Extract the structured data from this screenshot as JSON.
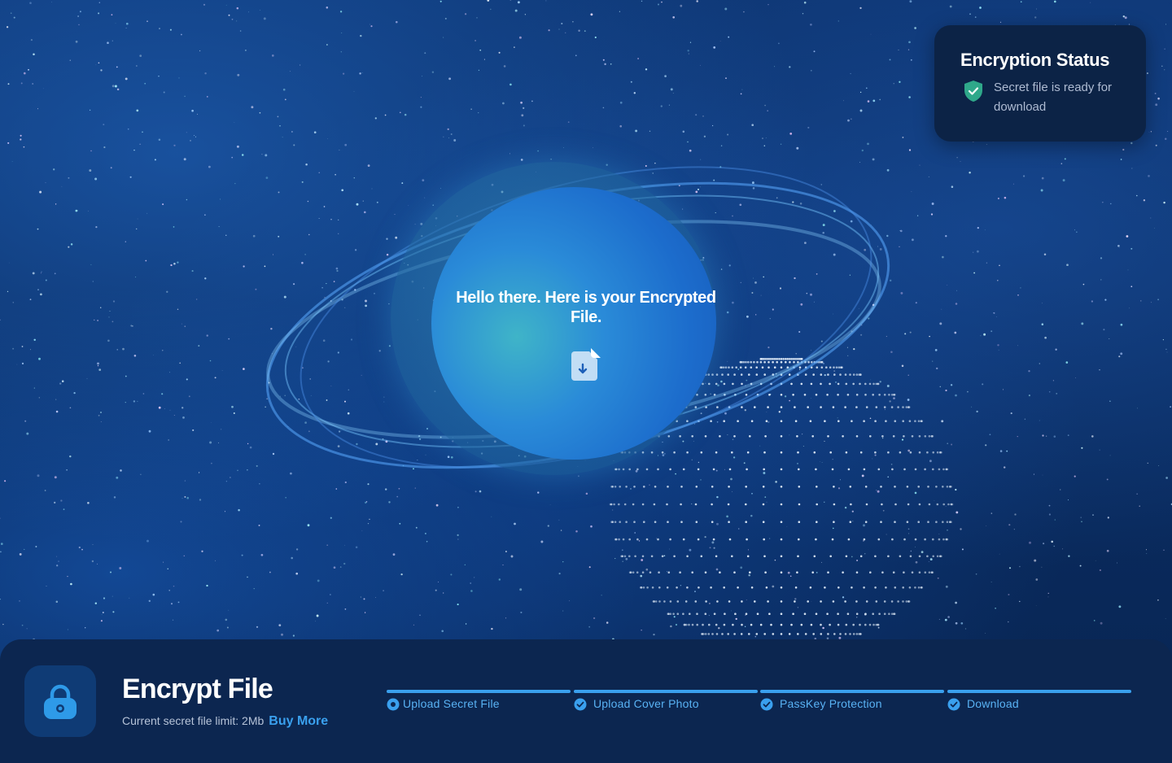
{
  "status_card": {
    "title": "Encryption Status",
    "message": "Secret file is ready for download",
    "icon": "shield-check-icon"
  },
  "main": {
    "message": "Hello there. Here is your Encrypted File.",
    "download_icon": "file-download-icon"
  },
  "bottom_bar": {
    "title": "Encrypt File",
    "limit_text": "Current secret file limit: 2Mb",
    "buy_more_label": "Buy More",
    "lock_icon": "lock-icon"
  },
  "steps": [
    {
      "label": "Upload Secret File",
      "icon": "radio-dot-icon"
    },
    {
      "label": "Upload Cover Photo",
      "icon": "check-circle-icon"
    },
    {
      "label": "PassKey Protection",
      "icon": "check-circle-icon"
    },
    {
      "label": "Download",
      "icon": "check-circle-icon"
    }
  ],
  "colors": {
    "accent": "#3aa0ee",
    "background": "#0a2a5a",
    "panel": "#0c2650",
    "shield": "#2fa88a"
  }
}
